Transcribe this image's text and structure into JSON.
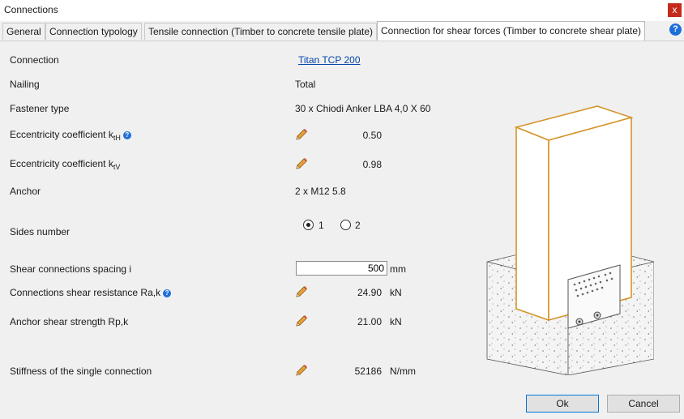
{
  "window": {
    "title": "Connections",
    "close_label": "x"
  },
  "tabs": [
    {
      "label": "General"
    },
    {
      "label": "Connection typology"
    },
    {
      "label": "Tensile connection (Timber to concrete tensile plate)"
    },
    {
      "label": "Connection for shear forces (Timber to concrete shear plate)",
      "active": true
    }
  ],
  "help_label": "?",
  "rows": {
    "connection": {
      "label": "Connection",
      "value": "Titan TCP 200"
    },
    "nailing": {
      "label": "Nailing",
      "value": "Total"
    },
    "fastener": {
      "label": "Fastener type",
      "value": "30  x  Chiodi Anker LBA 4,0 X 60"
    },
    "ecc_h": {
      "label": "Eccentricity coefficient  k",
      "sub": "tH",
      "value": "0.50"
    },
    "ecc_v": {
      "label": "Eccentricity coefficient  k",
      "sub": "tV",
      "value": "0.98"
    },
    "anchor": {
      "label": "Anchor",
      "value": "2  x  M12 5.8"
    },
    "sides": {
      "label": "Sides number",
      "options": [
        "1",
        "2"
      ],
      "selected": "1"
    },
    "spacing": {
      "label": "Shear connections spacing i",
      "value": "500",
      "unit": "mm"
    },
    "resistance": {
      "label": "Connections shear resistance Ra,k",
      "value": "24.90",
      "unit": "kN"
    },
    "anchor_strength": {
      "label": "Anchor shear strength  Rp,k",
      "value": "21.00",
      "unit": "kN"
    },
    "stiffness": {
      "label": "Stiffness of the single connection",
      "value": "52186",
      "unit": "N/mm"
    }
  },
  "buttons": {
    "ok": "Ok",
    "cancel": "Cancel"
  },
  "colors": {
    "timber_edge": "#d4952a",
    "info_blue": "#1e6fd9",
    "pencil": "#e8a13a"
  }
}
